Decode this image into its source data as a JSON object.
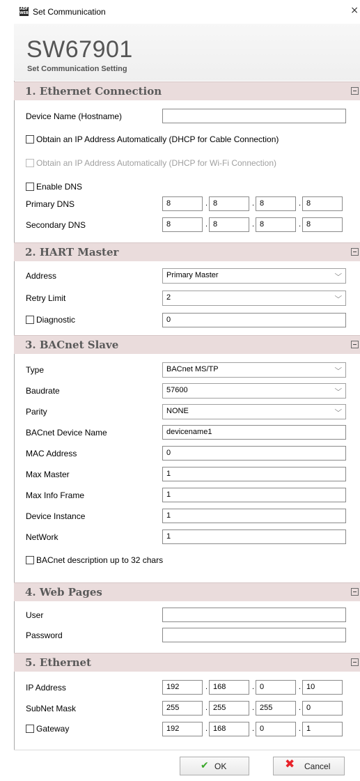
{
  "window": {
    "title": "Set Communication",
    "icon_text": "ADF WEB",
    "close_glyph": "×"
  },
  "header": {
    "product": "SW67901",
    "subtitle": "Set Communication Setting"
  },
  "ethernet_connection": {
    "title": "1. Ethernet Connection",
    "device_name_label": "Device Name (Hostname)",
    "device_name_value": "",
    "dhcp_cable_label": "Obtain an IP Address Automatically (DHCP for Cable Connection)",
    "dhcp_wifi_label": "Obtain an IP Address Automatically (DHCP for Wi-Fi Connection)",
    "enable_dns_label": "Enable DNS",
    "primary_dns_label": "Primary DNS",
    "primary_dns": [
      "8",
      "8",
      "8",
      "8"
    ],
    "secondary_dns_label": "Secondary DNS",
    "secondary_dns": [
      "8",
      "8",
      "8",
      "8"
    ]
  },
  "hart_master": {
    "title": "2. HART Master",
    "address_label": "Address",
    "address_value": "Primary Master",
    "retry_label": "Retry Limit",
    "retry_value": "2",
    "diagnostic_label": "Diagnostic",
    "diagnostic_value": "0"
  },
  "bacnet_slave": {
    "title": "3. BACnet Slave",
    "type_label": "Type",
    "type_value": "BACnet MS/TP",
    "baudrate_label": "Baudrate",
    "baudrate_value": "57600",
    "parity_label": "Parity",
    "parity_value": "NONE",
    "device_name_label": "BACnet Device Name",
    "device_name_value": "devicename1",
    "mac_label": "MAC Address",
    "mac_value": "0",
    "max_master_label": "Max Master",
    "max_master_value": "1",
    "max_info_label": "Max Info Frame",
    "max_info_value": "1",
    "instance_label": "Device Instance",
    "instance_value": "1",
    "network_label": "NetWork",
    "network_value": "1",
    "desc32_label": "BACnet description up to 32 chars"
  },
  "web_pages": {
    "title": "4. Web Pages",
    "user_label": "User",
    "user_value": "",
    "password_label": "Password",
    "password_value": ""
  },
  "ethernet": {
    "title": "5. Ethernet",
    "ip_label": "IP Address",
    "ip": [
      "192",
      "168",
      "0",
      "10"
    ],
    "mask_label": "SubNet Mask",
    "mask": [
      "255",
      "255",
      "255",
      "0"
    ],
    "gateway_label": "Gateway",
    "gateway": [
      "192",
      "168",
      "0",
      "1"
    ]
  },
  "footer": {
    "ok_label": "OK",
    "cancel_label": "Cancel"
  },
  "colors": {
    "section_bg": "#eadcdc",
    "ok_check": "#3aa82a",
    "cancel_x": "#e8232a"
  }
}
